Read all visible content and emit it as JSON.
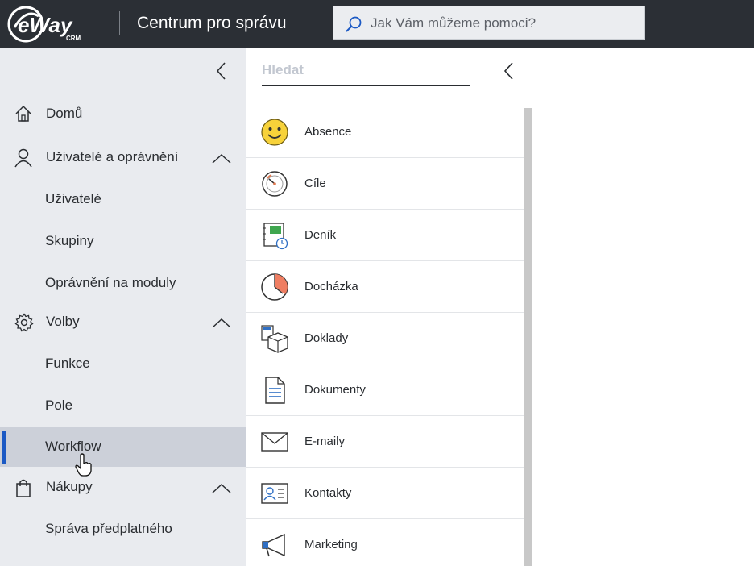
{
  "header": {
    "logo_text": "eWay",
    "logo_sub": "CRM",
    "title": "Centrum pro správu",
    "search_placeholder": "Jak Vám můžeme pomoci?"
  },
  "nav": {
    "items": [
      {
        "label": "Domů",
        "icon": "home-icon"
      },
      {
        "label": "Uživatelé a oprávnění",
        "icon": "user-icon",
        "expanded": true
      },
      {
        "label": "Uživatelé"
      },
      {
        "label": "Skupiny"
      },
      {
        "label": "Oprávnění na moduly"
      },
      {
        "label": "Volby",
        "icon": "gear-icon",
        "expanded": true
      },
      {
        "label": "Funkce"
      },
      {
        "label": "Pole"
      },
      {
        "label": "Workflow",
        "active": true
      },
      {
        "label": "Nákupy",
        "icon": "shopping-bag-icon",
        "expanded": true
      },
      {
        "label": "Správa předplatného"
      }
    ]
  },
  "panel": {
    "search_placeholder": "Hledat",
    "modules": [
      {
        "label": "Absence",
        "icon": "smiley-icon"
      },
      {
        "label": "Cíle",
        "icon": "gauge-icon"
      },
      {
        "label": "Deník",
        "icon": "journal-icon"
      },
      {
        "label": "Docházka",
        "icon": "clock-icon"
      },
      {
        "label": "Doklady",
        "icon": "box-document-icon"
      },
      {
        "label": "Dokumenty",
        "icon": "document-icon"
      },
      {
        "label": "E-maily",
        "icon": "envelope-icon"
      },
      {
        "label": "Kontakty",
        "icon": "contact-card-icon"
      },
      {
        "label": "Marketing",
        "icon": "megaphone-icon"
      }
    ]
  },
  "colors": {
    "topbar": "#2b2f35",
    "nav_bg": "#e9ebef",
    "active_bg": "#ccd0d9",
    "active_bar": "#1b59c4"
  }
}
